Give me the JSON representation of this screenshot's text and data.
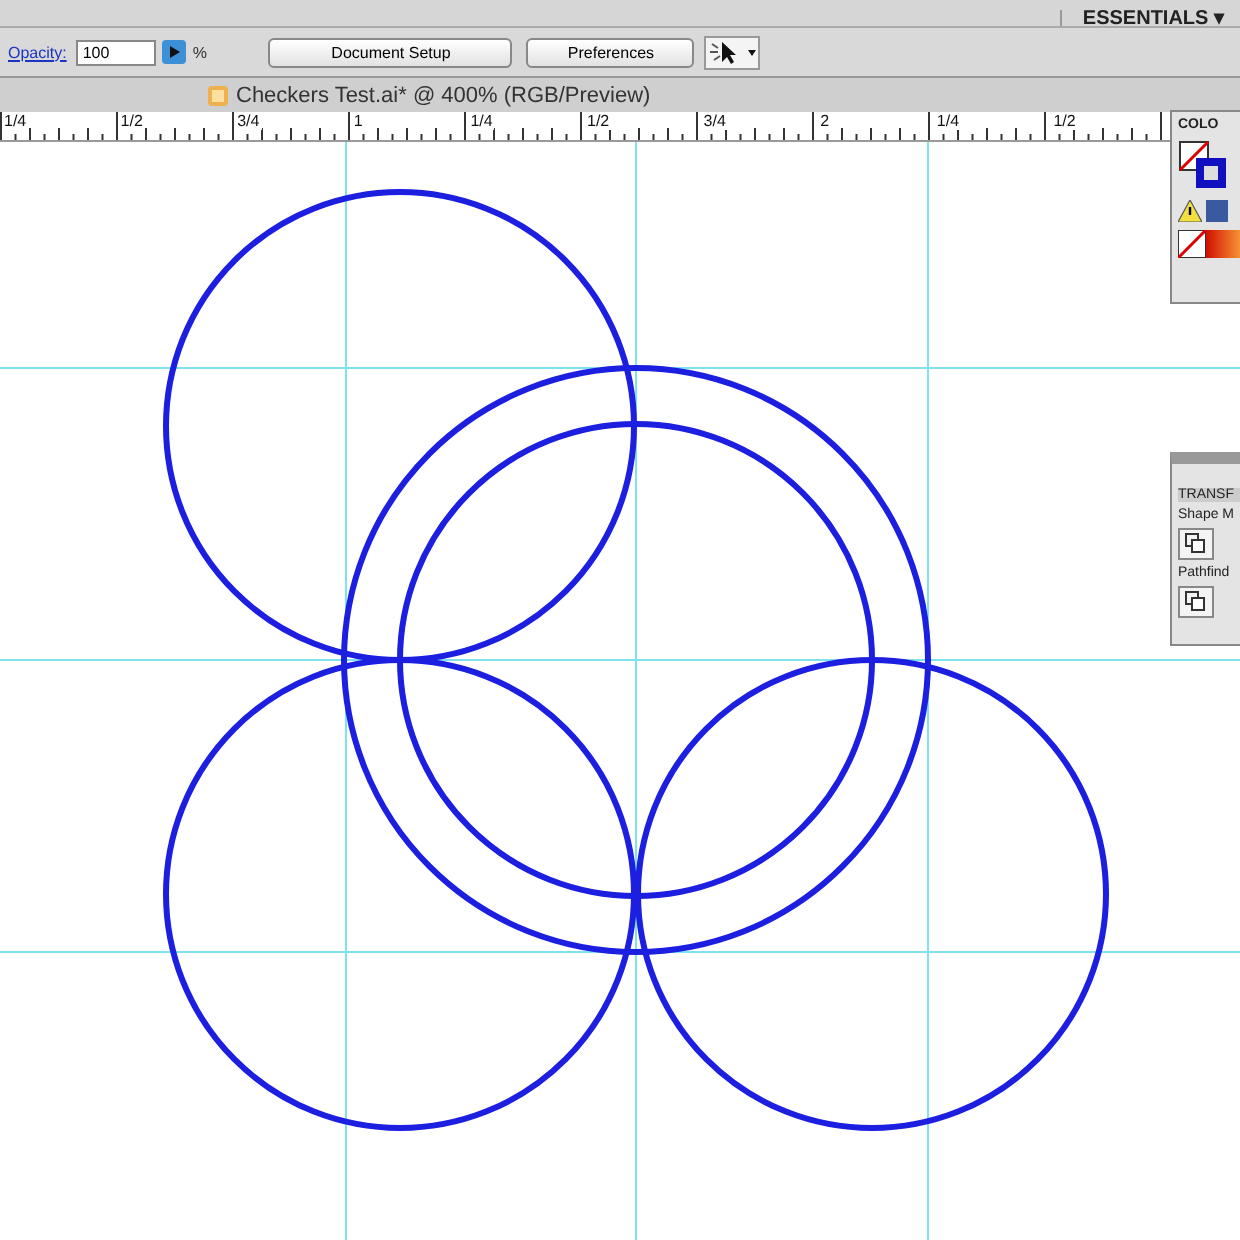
{
  "workspace_switcher": {
    "label": "ESSENTIALS",
    "caret": "▾"
  },
  "control_bar": {
    "opacity_label": "Opacity:",
    "opacity_value": "100",
    "percent": "%",
    "buttons": [
      "Document Setup",
      "Preferences"
    ]
  },
  "document_tab": {
    "title": "Checkers Test.ai* @ 400% (RGB/Preview)"
  },
  "ruler": {
    "labels": [
      "1/4",
      "1/2",
      "3/4",
      "1",
      "1/4",
      "1/2",
      "3/4",
      "2",
      "1/4",
      "1/2"
    ]
  },
  "color_panel": {
    "title": "COLO"
  },
  "transform_panel": {
    "title": "TRANSF",
    "sections": [
      "Shape M",
      "Pathfind"
    ]
  }
}
